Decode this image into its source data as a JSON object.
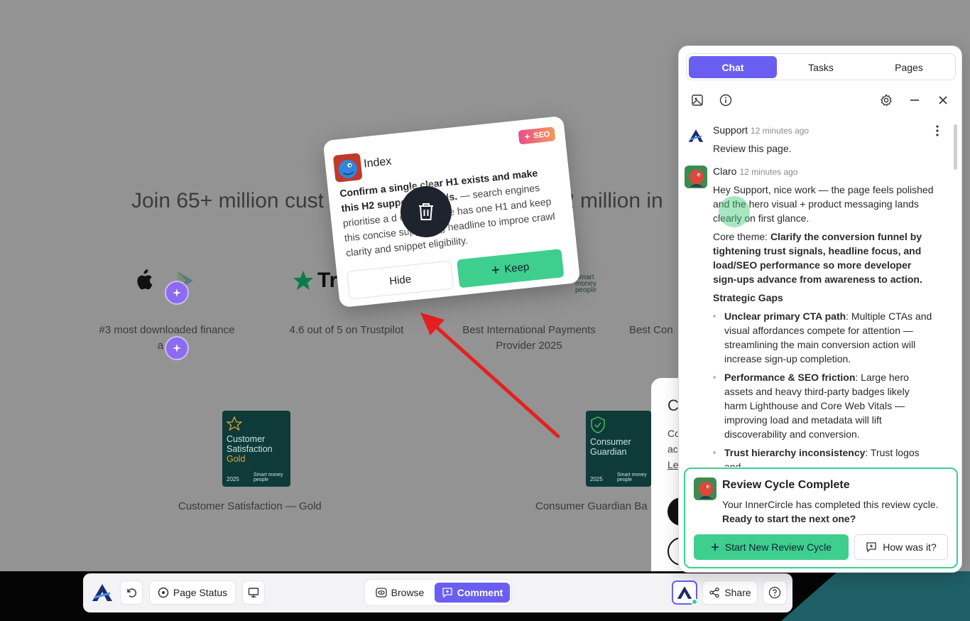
{
  "background_page": {
    "headline_start": "Join 65+ million cust",
    "headline_end": "2 million in",
    "stats": [
      {
        "label": "#3 most downloaded finance"
      },
      {
        "label": "a"
      },
      {
        "label": "4.6 out of 5 on Trustpilot"
      },
      {
        "label": "Best International Payments Provider 2025"
      },
      {
        "label": "Best Con"
      }
    ],
    "trust_partial": "Tru",
    "badges": [
      {
        "line1": "Customer",
        "line2": "Satisfaction",
        "line3": "Gold",
        "year": "2025",
        "caption": "Customer Satisfaction — Gold"
      },
      {
        "line1": "Consumer",
        "line2": "Guardian",
        "line3": "",
        "year": "2025",
        "caption": "Consumer Guardian Ba"
      }
    ],
    "smart_money": "Smart money people"
  },
  "peek_card": {
    "title": "C",
    "lines": [
      "Co",
      "ac",
      "Le"
    ]
  },
  "suggestion_card": {
    "title": "Index",
    "tag": "SEO",
    "body_bold": "Confirm a single clear H1 exists and make this H2 support ta",
    "body_bold_tail": "words.",
    "body_rest": "— search engines prioritise a d",
    "body_rest2": "ensure page has one H1 and keep this",
    "body_rest3": "concise supporting headline to impro",
    "body_rest4": "e crawl clarity and snippet eligibility.",
    "hide_label": "Hide",
    "keep_label": "Keep"
  },
  "chat_panel": {
    "tabs": [
      {
        "label": "Chat",
        "active": true
      },
      {
        "label": "Tasks",
        "active": false
      },
      {
        "label": "Pages",
        "active": false
      }
    ],
    "messages": {
      "support": {
        "name": "Support",
        "time": "12 minutes ago",
        "text": "Review this page."
      },
      "claro": {
        "name": "Claro",
        "time": "12 minutes ago",
        "intro": "Hey Support, nice work — the page feels polished and the hero visual + product messaging lands clearly on first glance.",
        "core_label": "Core theme: ",
        "core_text": "Clarify the conversion funnel by tightening trust signals, headline focus, and load/SEO performance so more developer sign-ups advance from awareness to action.",
        "gaps_title": "Strategic Gaps",
        "gaps": [
          {
            "title": "Unclear primary CTA path",
            "text": ": Multiple CTAs and visual affordances compete for attention — streamlining the main conversion action will increase sign-up completion."
          },
          {
            "title": "Performance & SEO friction",
            "text": ": Large hero assets and heavy third-party badges likely harm Lighthouse and Core Web Vitals — improving load and metadata will lift discoverability and conversion."
          },
          {
            "title": "Trust hierarchy inconsistency",
            "text": ": Trust logos and"
          }
        ]
      }
    },
    "review": {
      "title": "Review Cycle Complete",
      "desc": "Your InnerCircle has completed this review cycle.",
      "desc_bold": "Ready to start the next one?",
      "primary": "Start New Review Cycle",
      "secondary": "How was it?"
    }
  },
  "toolbar": {
    "page_status": "Page Status",
    "browse": "Browse",
    "comment": "Comment",
    "share": "Share"
  },
  "colors": {
    "accent": "#6a5ef1",
    "green": "#3ecf8e",
    "dark_teal": "#0e3b3a"
  }
}
